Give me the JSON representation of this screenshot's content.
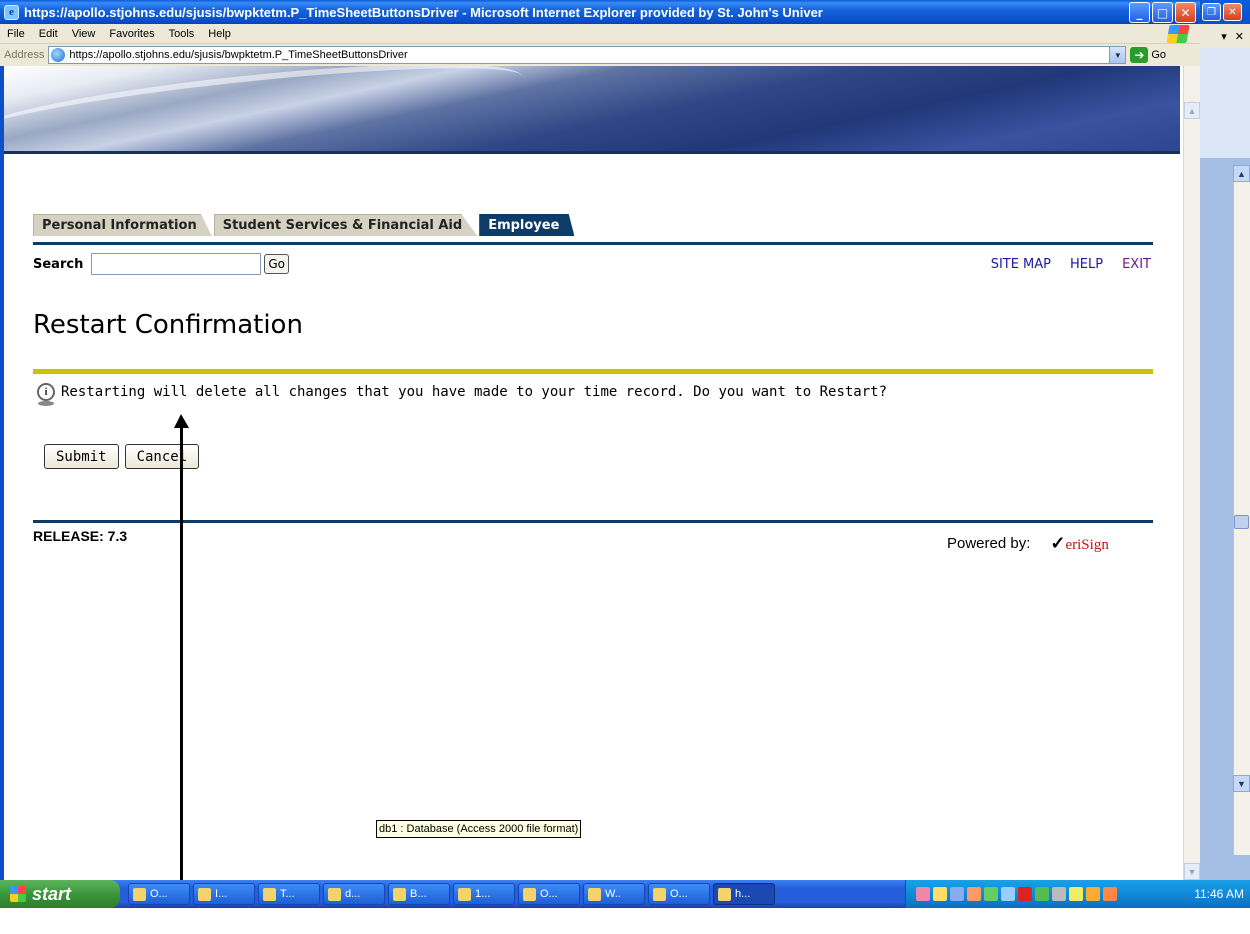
{
  "window": {
    "title": "https://apollo.stjohns.edu/sjusis/bwpktetm.P_TimeSheetButtonsDriver - Microsoft Internet Explorer provided by St. John's Univer",
    "min_glyph": "_",
    "max_glyph": "□",
    "close_glyph": "✕"
  },
  "menu": [
    "File",
    "Edit",
    "View",
    "Favorites",
    "Tools",
    "Help"
  ],
  "address": {
    "label": "Address",
    "url": "https://apollo.stjohns.edu/sjusis/bwpktetm.P_TimeSheetButtonsDriver",
    "go_label": "Go"
  },
  "tabs": [
    {
      "label": "Personal Information",
      "active": false
    },
    {
      "label": "Student Services & Financial Aid",
      "active": false
    },
    {
      "label": "Employee",
      "active": true
    }
  ],
  "search": {
    "label": "Search",
    "value": "",
    "go_label": "Go"
  },
  "toplinks": {
    "site_map": "SITE MAP",
    "help": "HELP",
    "exit": "EXIT"
  },
  "page": {
    "title": "Restart Confirmation",
    "info_message": "Restarting will delete all changes that you have made to your time record. Do you want to Restart?",
    "submit_label": "Submit",
    "cancel_label": "Cancel"
  },
  "footer": {
    "release": "RELEASE: 7.3",
    "powered_by": "Powered by:",
    "brand_check": "✓",
    "brand_text": "eriSign"
  },
  "tooltip": "db1 : Database (Access 2000 file format)",
  "taskbar": {
    "start_label": "start",
    "items": [
      {
        "label": "O..."
      },
      {
        "label": "I..."
      },
      {
        "label": "T..."
      },
      {
        "label": "d..."
      },
      {
        "label": "B..."
      },
      {
        "label": "1..."
      },
      {
        "label": "O..."
      },
      {
        "label": "W.."
      },
      {
        "label": "O..."
      },
      {
        "label": "h..."
      }
    ],
    "clock": "11:46 AM"
  },
  "colors": {
    "tab_active": "#0e3c68",
    "title_rule": "#c8c400",
    "link": "#1a1aa6",
    "exit_link": "#6b1a8a"
  }
}
